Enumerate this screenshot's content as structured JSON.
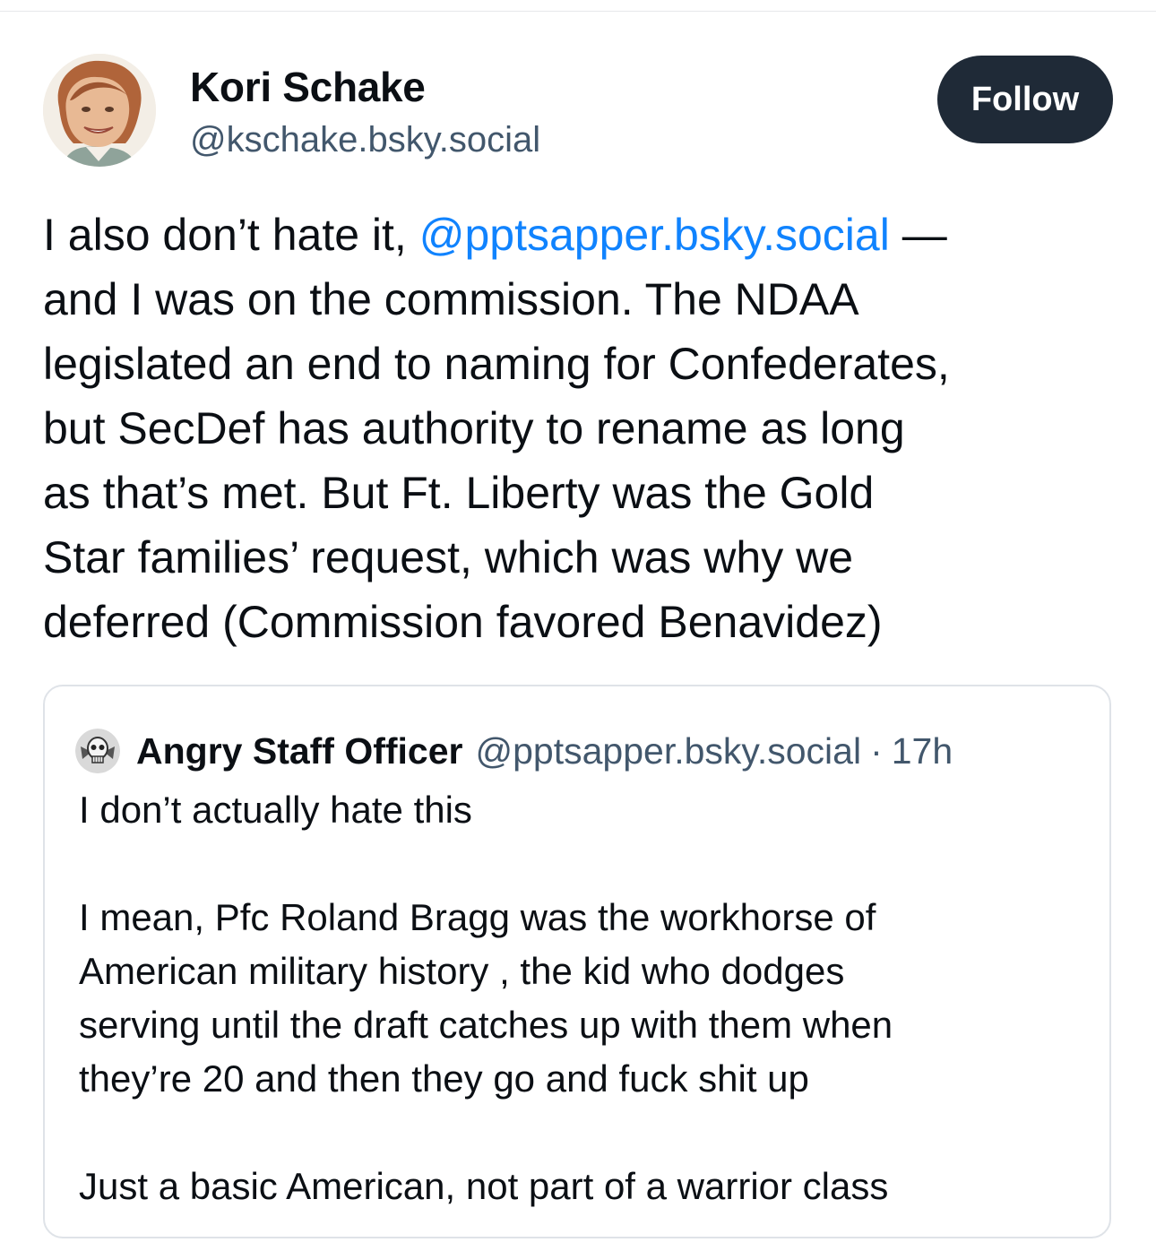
{
  "post": {
    "author_name": "Kori Schake",
    "author_handle": "@kschake.bsky.social",
    "follow_label": "Follow",
    "text_lines": [
      {
        "before": "I also don’t hate it, ",
        "mention": "@pptsapper.bsky.social",
        "after": " —"
      },
      {
        "text": "and I was on the commission.  The NDAA"
      },
      {
        "text": "legislated an end to naming for Confederates,"
      },
      {
        "text": "but SecDef has authority to rename as long"
      },
      {
        "text": "as that’s met.  But Ft. Liberty was the Gold"
      },
      {
        "text": "Star families’ request, which was why we"
      },
      {
        "text": "deferred (Commission favored Benavidez)"
      }
    ]
  },
  "quote": {
    "author_name": "Angry Staff Officer",
    "author_handle": "@pptsapper.bsky.social",
    "separator": "·",
    "time": "17h",
    "text_lines": [
      "I don’t actually hate this",
      "",
      "I mean, Pfc Roland Bragg was the workhorse of",
      "American military history , the kid who dodges",
      "serving until the draft catches up with them when",
      "they’re 20 and then they go and fuck shit up",
      "",
      "Just a basic American, not part of a warrior class"
    ]
  },
  "colors": {
    "mention": "#1083fe",
    "follow_button_bg": "#1f2a37",
    "handle_text": "#42576c"
  }
}
